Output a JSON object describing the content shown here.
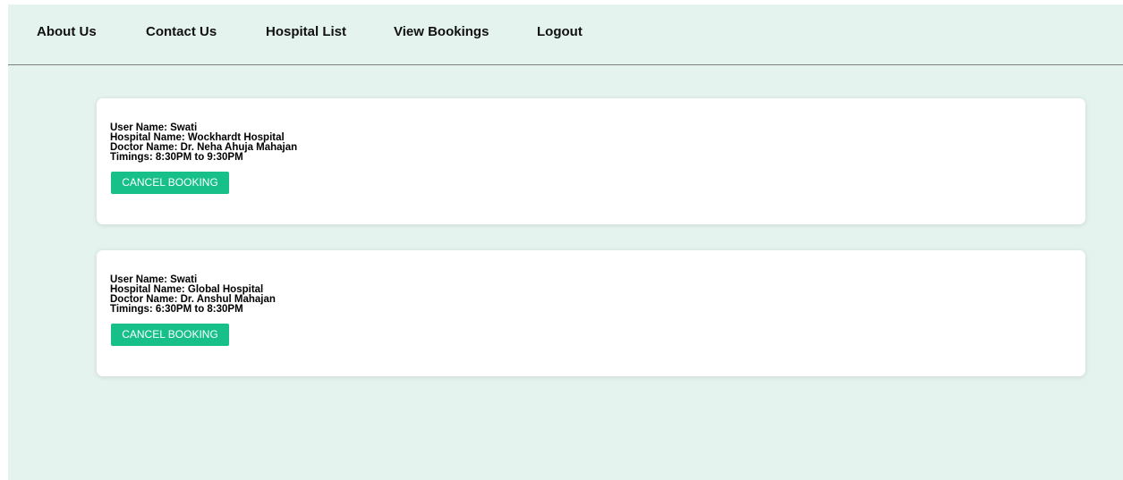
{
  "nav": {
    "items": [
      {
        "label": "About Us"
      },
      {
        "label": "Contact Us"
      },
      {
        "label": "Hospital List"
      },
      {
        "label": "View Bookings"
      },
      {
        "label": "Logout"
      }
    ]
  },
  "bookings": [
    {
      "user_name": "User Name: Swati",
      "hospital_name": "Hospital Name: Wockhardt Hospital",
      "doctor_name": "Doctor Name: Dr. Neha Ahuja Mahajan",
      "timings": "Timings: 8:30PM to 9:30PM",
      "cancel_label": "CANCEL BOOKING"
    },
    {
      "user_name": "User Name: Swati",
      "hospital_name": "Hospital Name: Global Hospital",
      "doctor_name": "Doctor Name: Dr. Anshul Mahajan",
      "timings": "Timings: 6:30PM to 8:30PM",
      "cancel_label": "CANCEL BOOKING"
    }
  ],
  "colors": {
    "background": "#e5f3ef",
    "card": "#ffffff",
    "button": "#16c088",
    "button_text": "#ffffff"
  }
}
